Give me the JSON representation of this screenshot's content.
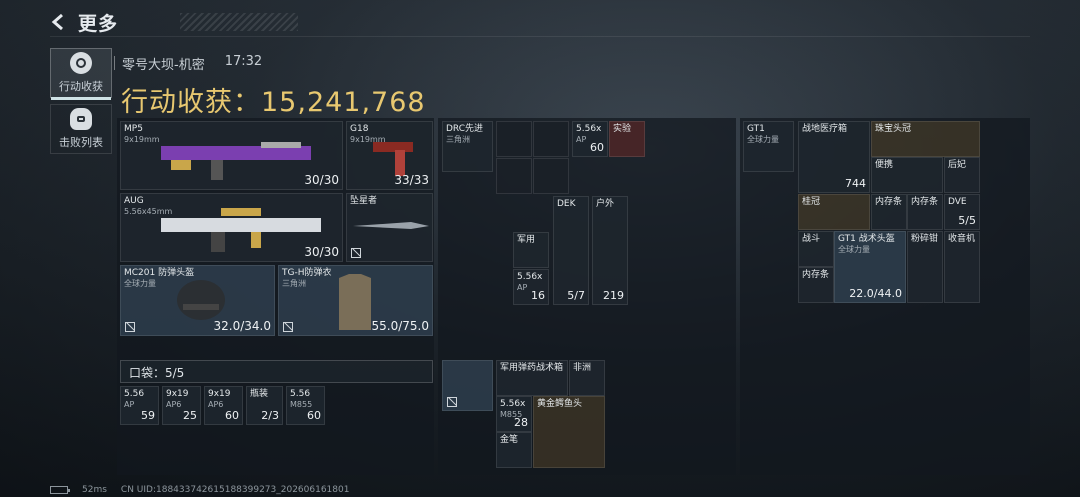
{
  "header": {
    "back_label": "更多"
  },
  "side_tabs": [
    {
      "label": "行动收获",
      "active": true
    },
    {
      "label": "击败列表",
      "active": false
    }
  ],
  "match": {
    "map": "零号大坝-机密",
    "time": "17:32"
  },
  "earnings": {
    "text": "行动收获：15,241,768"
  },
  "weapons": [
    {
      "name": "MP5",
      "sub": "9x19mm",
      "ammo": "30/30"
    },
    {
      "name": "G18",
      "sub": "9x19mm",
      "ammo": "33/33"
    },
    {
      "name": "AUG",
      "sub": "5.56x45mm",
      "ammo": "30/30"
    },
    {
      "name": "坠星者",
      "sub": "",
      "ammo": ""
    }
  ],
  "armor": [
    {
      "name": "MC201 防弹头盔",
      "sub": "全球力量",
      "durability": "32.0/34.0"
    },
    {
      "name": "TG-H防弹衣",
      "sub": "三角洲",
      "durability": "55.0/75.0"
    }
  ],
  "pocket": {
    "label": "口袋：5/5"
  },
  "pocket_items": [
    {
      "name": "5.56",
      "sub": "AP",
      "count": "59"
    },
    {
      "name": "9x19",
      "sub": "AP6",
      "count": "25"
    },
    {
      "name": "9x19",
      "sub": "AP6",
      "count": "60"
    },
    {
      "name": "瓶装",
      "sub": "",
      "count": "2/3"
    },
    {
      "name": "5.56",
      "sub": "M855",
      "count": "60"
    }
  ],
  "rig": [
    {
      "name": "DRC先进",
      "sub": "三角洲",
      "count": ""
    },
    {
      "name": "5.56x",
      "sub": "AP",
      "count": "60"
    },
    {
      "name": "实验",
      "sub": "",
      "count": ""
    }
  ],
  "rig_lower": [
    {
      "name": "军用",
      "sub": "",
      "count": ""
    },
    {
      "name": "DEK",
      "sub": "",
      "count": "5/7"
    },
    {
      "name": "户外",
      "sub": "",
      "count": "219"
    },
    {
      "name": "5.56x",
      "sub": "AP",
      "count": "16"
    }
  ],
  "bag": [
    {
      "name": "",
      "sub": "",
      "count": ""
    },
    {
      "name": "军用弹药战术箱",
      "sub": "",
      "count": ""
    },
    {
      "name": "非洲",
      "sub": "",
      "count": ""
    },
    {
      "name": "5.56x",
      "sub": "M855",
      "count": "28"
    },
    {
      "name": "黄金鳄鱼头",
      "sub": "",
      "count": ""
    },
    {
      "name": "金笔",
      "sub": "",
      "count": ""
    }
  ],
  "backpack": [
    {
      "name": "GT1",
      "sub": "全球力量",
      "count": ""
    },
    {
      "name": "战地医疗箱",
      "sub": "",
      "count": "744"
    },
    {
      "name": "珠宝头冠",
      "sub": "",
      "count": ""
    },
    {
      "name": "便携",
      "sub": "",
      "count": ""
    },
    {
      "name": "后妃",
      "sub": "",
      "count": ""
    },
    {
      "name": "桂冠",
      "sub": "",
      "count": ""
    },
    {
      "name": "内存条",
      "sub": "",
      "count": ""
    },
    {
      "name": "内存条",
      "sub": "",
      "count": ""
    },
    {
      "name": "DVE",
      "sub": "",
      "count": "5/5"
    },
    {
      "name": "战斗",
      "sub": "",
      "count": ""
    },
    {
      "name": "GT1 战术头盔",
      "sub": "全球力量",
      "count": "22.0/44.0"
    },
    {
      "name": "粉碎钳",
      "sub": "",
      "count": ""
    },
    {
      "name": "收音机",
      "sub": "",
      "count": ""
    },
    {
      "name": "内存条",
      "sub": "",
      "count": ""
    }
  ],
  "footer": {
    "ping": "52ms",
    "uid": "CN UID:1884337426151883992​73_202606161801"
  },
  "colors": {
    "gold": "#e8c870",
    "accent": "#cfe3e6"
  }
}
